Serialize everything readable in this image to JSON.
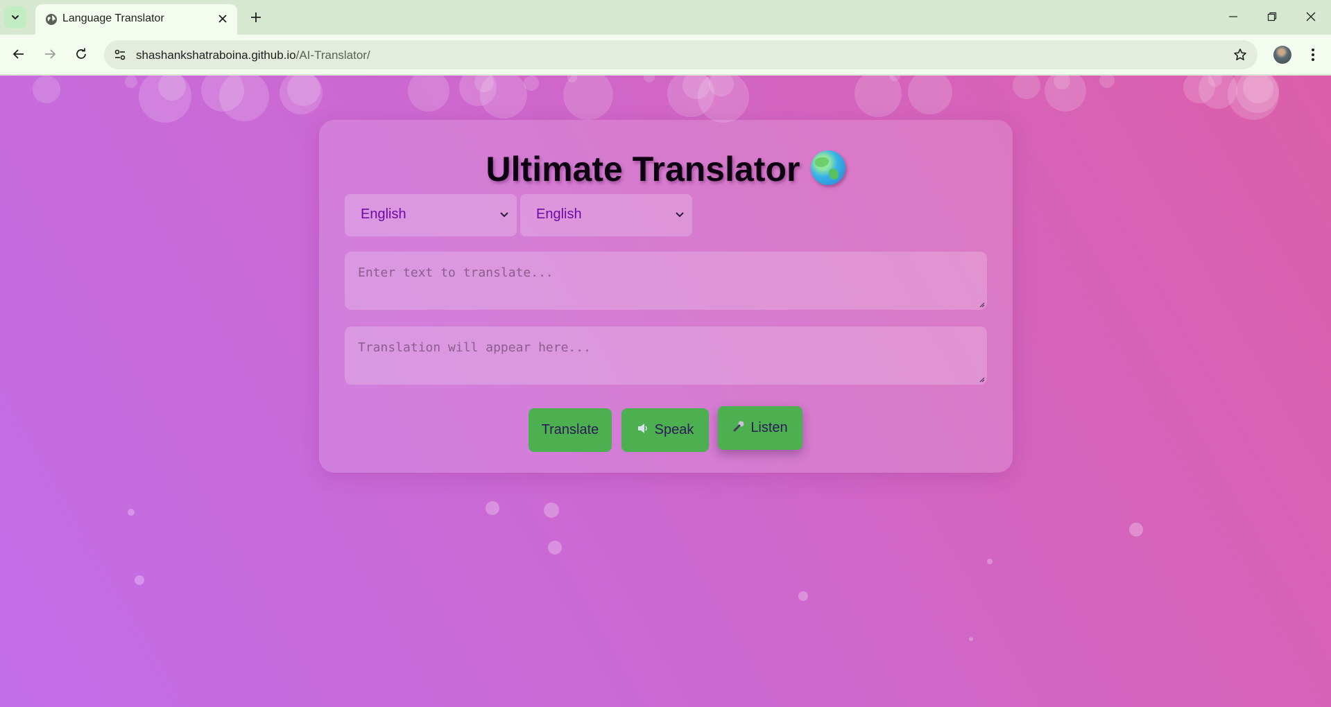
{
  "browser": {
    "tab_title": "Language Translator",
    "url_host": "shashankshatraboina.github.io",
    "url_path": "/AI-Translator/",
    "icons": {
      "tab_menu": "chevron-down-icon",
      "favicon": "globe-icon",
      "tab_close": "close-icon",
      "new_tab": "plus-icon",
      "back": "back-arrow-icon",
      "forward": "forward-arrow-icon",
      "reload": "reload-icon",
      "site_info": "tune-icon",
      "bookmark": "star-icon",
      "menu": "kebab-icon",
      "minimize": "minimize-icon",
      "restore": "restore-icon",
      "close_window": "close-icon"
    }
  },
  "app": {
    "title": "Ultimate Translator",
    "title_icon": "globe-emoji",
    "source_language": "English",
    "target_language": "English",
    "input_placeholder": "Enter text to translate...",
    "output_placeholder": "Translation will appear here...",
    "buttons": {
      "translate": "Translate",
      "speak": "Speak",
      "listen": "Listen"
    },
    "colors": {
      "button": "#4caf50",
      "select_text": "#6d0aa6",
      "background_start": "#c26ee9",
      "background_end": "#dc5fa9"
    }
  }
}
